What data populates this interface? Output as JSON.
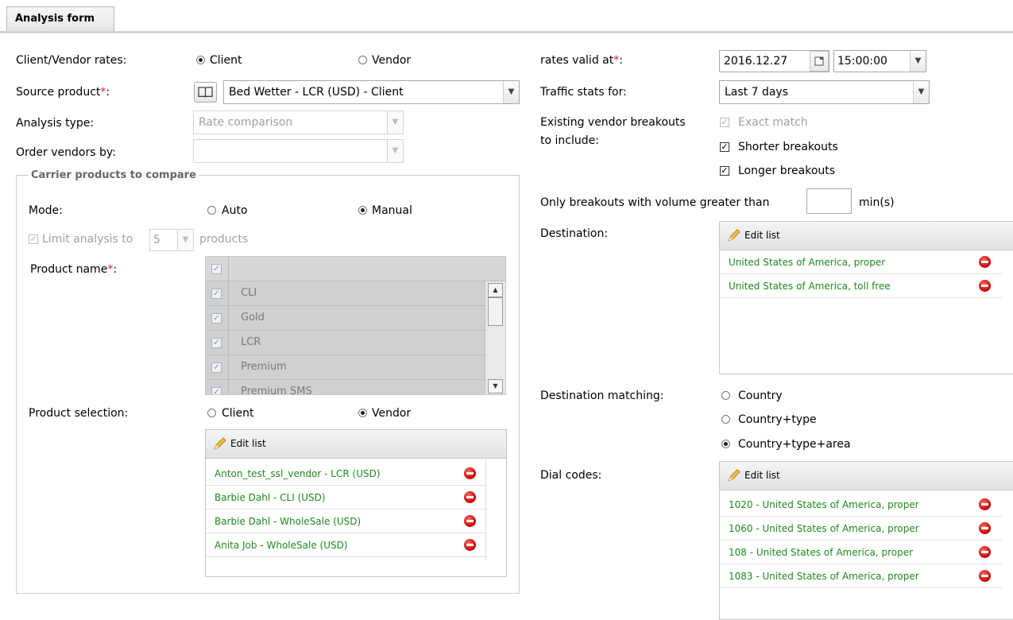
{
  "tab": {
    "label": "Analysis form"
  },
  "left": {
    "client_vendor_rates": {
      "label": "Client/Vendor rates:",
      "options": [
        "Client",
        "Vendor"
      ],
      "selected": "Client"
    },
    "source_product": {
      "label": "Source product",
      "required": "*",
      "colon": ":",
      "value": "Bed Wetter - LCR (USD) - Client"
    },
    "analysis_type": {
      "label": "Analysis type:",
      "value": "Rate comparison"
    },
    "order_vendors_by": {
      "label": "Order vendors by:",
      "value": ""
    },
    "carrier_products": {
      "legend": "Carrier products to compare",
      "mode": {
        "label": "Mode:",
        "options": [
          "Auto",
          "Manual"
        ],
        "selected": "Manual"
      },
      "limit": {
        "prefix": "Limit analysis to",
        "value": "5",
        "suffix": "products",
        "checked": true
      },
      "product_name": {
        "label": "Product name",
        "required": "*",
        "colon": ":"
      },
      "products": [
        {
          "name": "CLI",
          "checked": true
        },
        {
          "name": "Gold",
          "checked": true
        },
        {
          "name": "LCR",
          "checked": true
        },
        {
          "name": "Premium",
          "checked": true
        },
        {
          "name": "Premium SMS",
          "checked": true
        }
      ],
      "product_selection": {
        "label": "Product selection:",
        "options": [
          "Client",
          "Vendor"
        ],
        "selected": "Vendor"
      },
      "vendor_list": {
        "edit_label": "Edit list",
        "items": [
          "Anton_test_ssl_vendor - LCR (USD)",
          "Barbie Dahl - CLI (USD)",
          "Barbie Dahl - WholeSale (USD)",
          "Anita Job - WholeSale (USD)"
        ]
      }
    }
  },
  "right": {
    "rates_valid_at": {
      "label": "rates valid at",
      "required": "*",
      "colon": ":",
      "date": "2016.12.27",
      "time": "15:00:00"
    },
    "traffic_stats": {
      "label": "Traffic stats for:",
      "value": "Last 7 days"
    },
    "existing_breakouts": {
      "label_line1": "Existing vendor breakouts",
      "label_line2": "to include:",
      "options": [
        {
          "label": "Exact match",
          "checked": true,
          "disabled": true
        },
        {
          "label": "Shorter breakouts",
          "checked": true,
          "disabled": false
        },
        {
          "label": "Longer breakouts",
          "checked": true,
          "disabled": false
        }
      ]
    },
    "volume": {
      "prefix": "Only breakouts with volume greater than",
      "value": "",
      "suffix": "min(s)"
    },
    "destination": {
      "label": "Destination:",
      "edit_label": "Edit list",
      "items": [
        "United States of America, proper",
        "United States of America, toll free"
      ]
    },
    "destination_matching": {
      "label": "Destination matching:",
      "options": [
        "Country",
        "Country+type",
        "Country+type+area"
      ],
      "selected": "Country+type+area"
    },
    "dial_codes": {
      "label": "Dial codes:",
      "edit_label": "Edit list",
      "items": [
        "1020 - United States of America, proper",
        "1060 - United States of America, proper",
        "108 - United States of America, proper",
        "1083 - United States of America, proper"
      ]
    }
  },
  "colors": {
    "required": "#e02020",
    "list_text": "#1e8a1e",
    "remove": "#c40000"
  }
}
